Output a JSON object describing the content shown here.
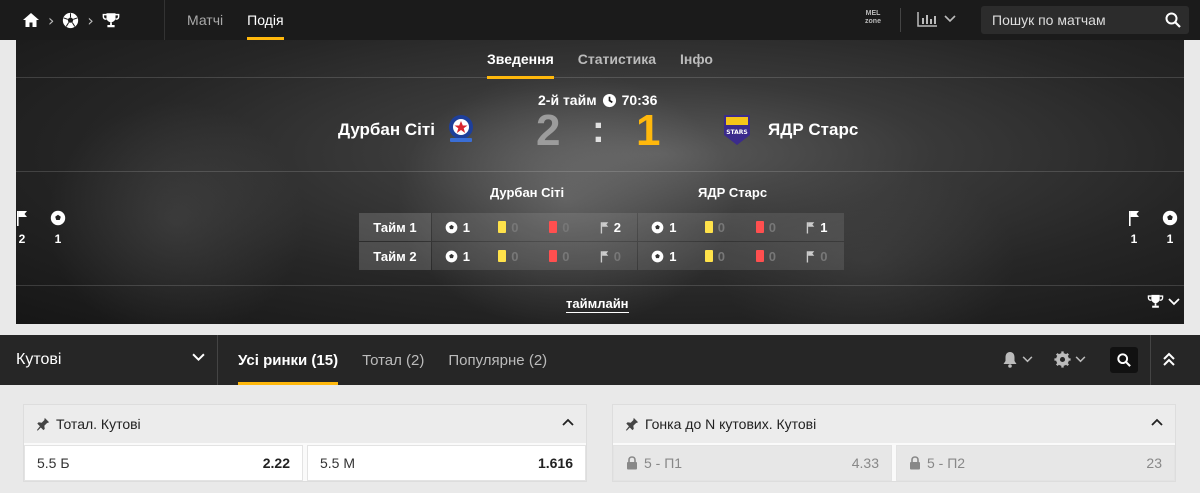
{
  "nav": {
    "breadcrumb_icons": [
      "home-icon",
      "soccer-ball-icon",
      "trophy-icon"
    ],
    "tabs": [
      {
        "label": "Матчі",
        "active": false
      },
      {
        "label": "Подія",
        "active": true
      }
    ],
    "mel_badge": "MEL zone",
    "search_placeholder": "Пошук по матчам"
  },
  "event": {
    "subtabs": [
      {
        "label": "Зведення",
        "active": true
      },
      {
        "label": "Статистика",
        "active": false
      },
      {
        "label": "Інфо",
        "active": false
      }
    ],
    "period": "2-й тайм",
    "clock": "70:36",
    "home": {
      "name": "Дурбан Сіті",
      "score": "2",
      "corners_total": "2",
      "goals_total": "1"
    },
    "away": {
      "name": "ЯДР Старс",
      "score": "1",
      "corners_total": "1",
      "goals_total": "1"
    },
    "colon": ":",
    "stats": [
      {
        "label": "Тайм 1",
        "home": {
          "goals": "1",
          "yellow": "0",
          "red": "0",
          "corners": "2"
        },
        "away": {
          "goals": "1",
          "yellow": "0",
          "red": "0",
          "corners": "1"
        }
      },
      {
        "label": "Тайм 2",
        "home": {
          "goals": "1",
          "yellow": "0",
          "red": "0",
          "corners": "0"
        },
        "away": {
          "goals": "1",
          "yellow": "0",
          "red": "0",
          "corners": "0"
        }
      }
    ],
    "timeline_link": "таймлайн"
  },
  "markets_bar": {
    "selected_market": "Кутові",
    "tabs": [
      {
        "label": "Усі ринки (15)",
        "active": true
      },
      {
        "label": "Тотал (2)",
        "active": false
      },
      {
        "label": "Популярне (2)",
        "active": false
      }
    ]
  },
  "markets": [
    {
      "title": "Тотал. Кутові",
      "odds": [
        {
          "label": "5.5 Б",
          "price": "2.22",
          "locked": false
        },
        {
          "label": "5.5 М",
          "price": "1.616",
          "locked": false
        }
      ]
    },
    {
      "title": "Гонка до N кутових. Кутові",
      "odds": [
        {
          "label": "5 - П1",
          "price": "4.33",
          "locked": true
        },
        {
          "label": "5 - П2",
          "price": "23",
          "locked": true
        }
      ]
    }
  ],
  "colors": {
    "accent": "#ffb80c",
    "yellow_card": "#ffe24a",
    "red_card": "#ff4f4f",
    "topbar": "#1b1b1b"
  }
}
